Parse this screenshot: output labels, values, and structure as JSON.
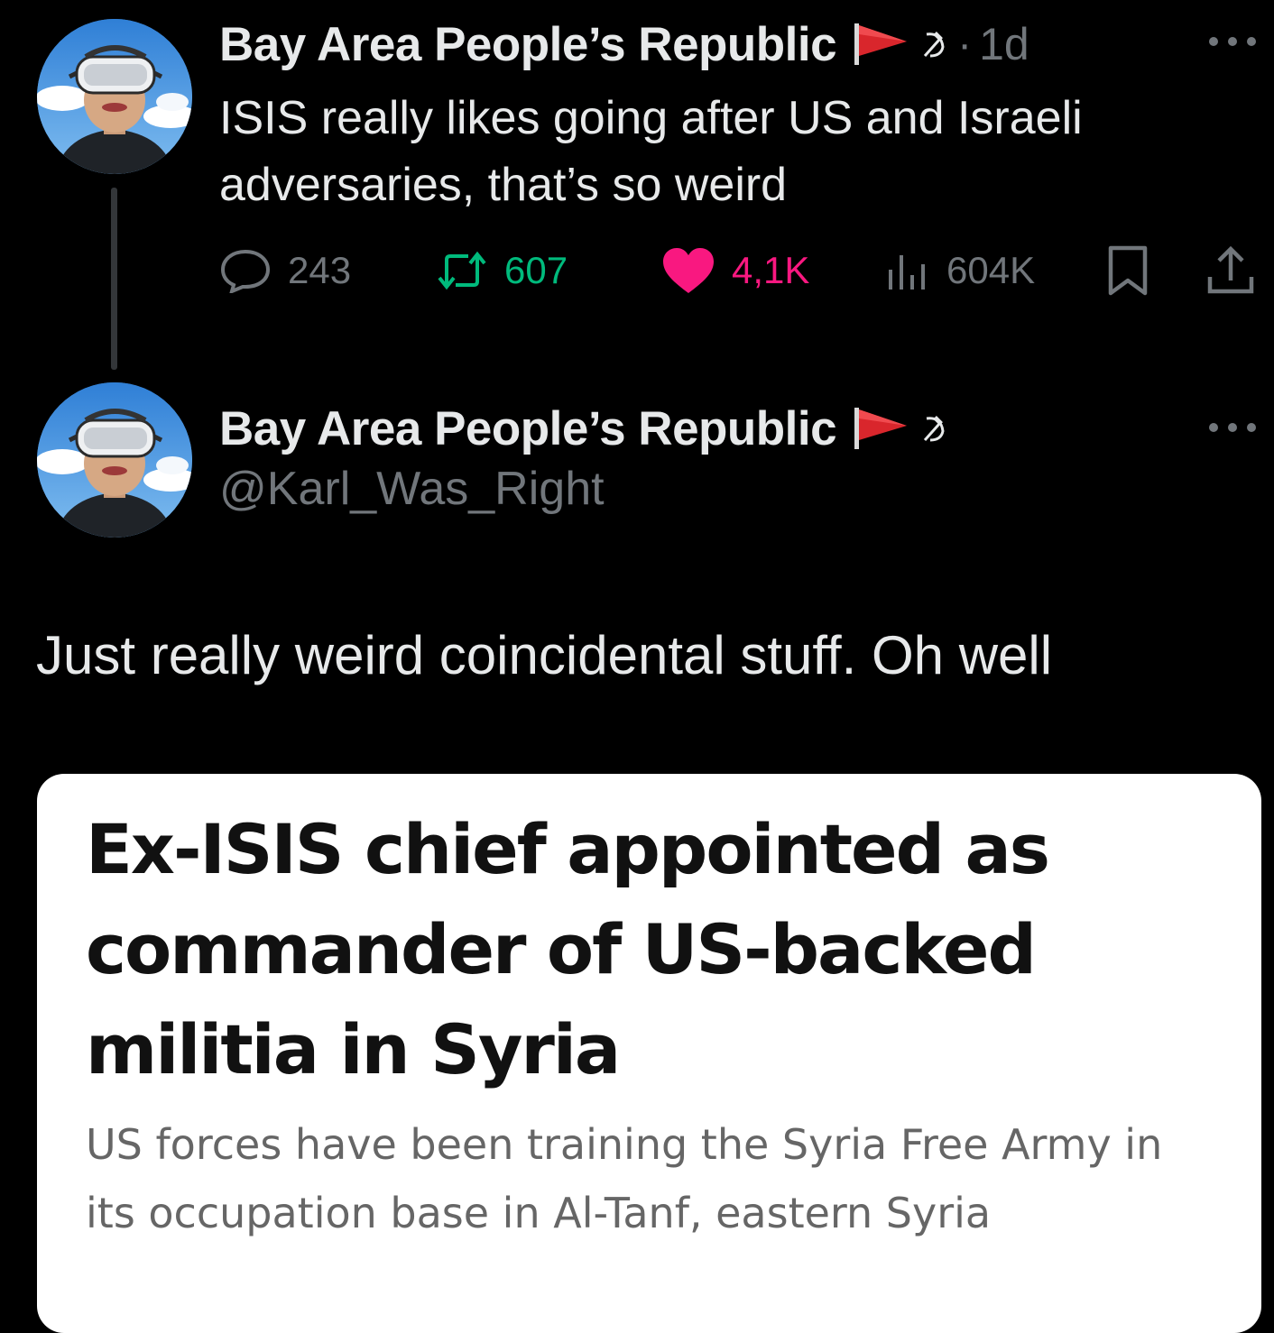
{
  "parent_tweet": {
    "display_name": "Bay Area People’s Republic",
    "flag_icon": "red-flag-icon",
    "badge_icon": "hammer-sickle-icon",
    "separator": "·",
    "timestamp": "1d",
    "text": "ISIS really likes going after US and Israeli adversaries, that’s so weird",
    "actions": {
      "replies": "243",
      "retweets": "607",
      "likes": "4,1K",
      "views": "604K"
    },
    "colors": {
      "retweet": "#00ba7c",
      "like": "#f91880",
      "muted": "#71767b"
    }
  },
  "reply_tweet": {
    "display_name": "Bay Area People’s Republic",
    "handle": "@Karl_Was_Right",
    "text": "Just really weird coincidental stuff. Oh well"
  },
  "article_card": {
    "title": "Ex-ISIS chief appointed as commander of US-backed militia in Syria",
    "description": "US forces have been training the Syria Free Army in its occupation base in Al-Tanf, eastern Syria"
  }
}
